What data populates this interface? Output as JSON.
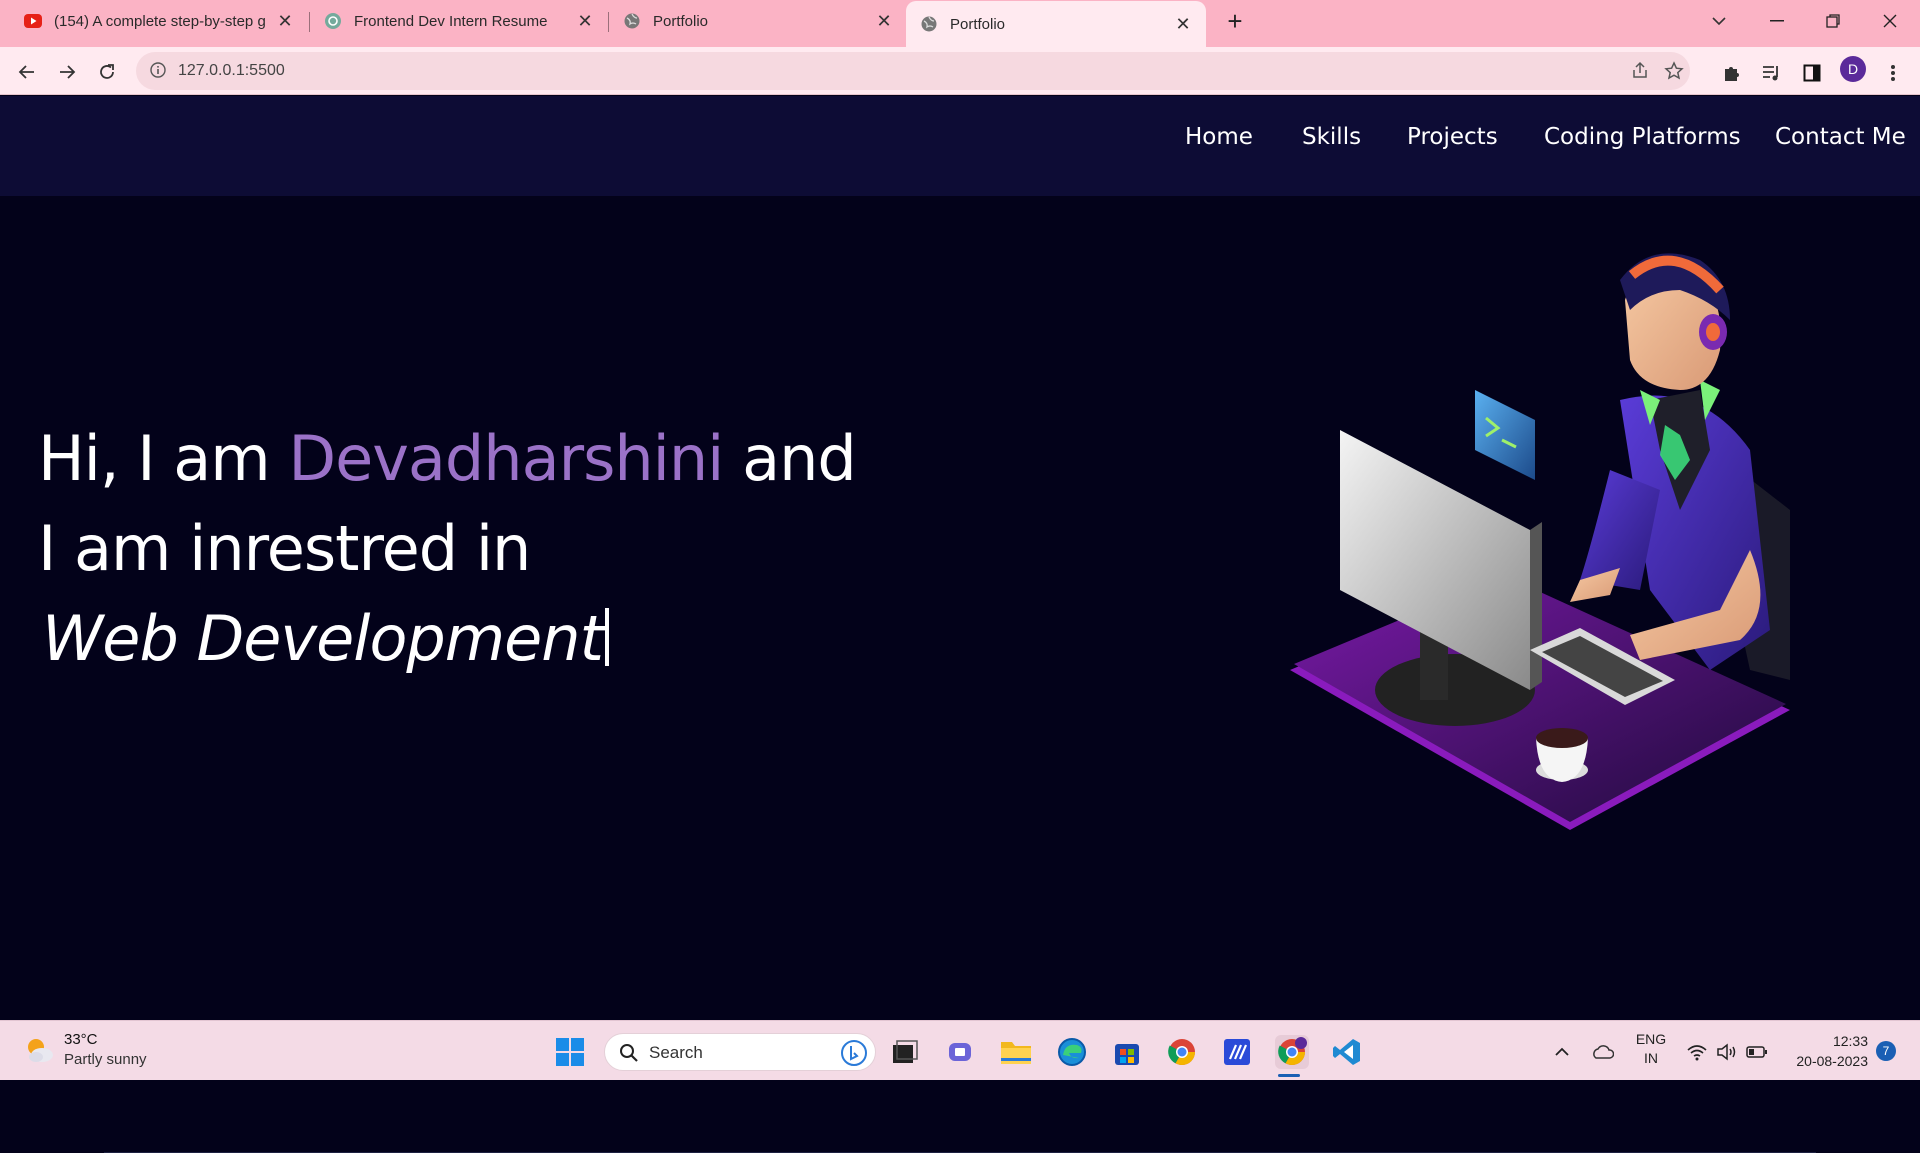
{
  "browser": {
    "tabs": [
      {
        "title": "(154) A complete step-by-step g",
        "favicon": "youtube-icon"
      },
      {
        "title": "Frontend Dev Intern Resume",
        "favicon": "chatgpt-icon"
      },
      {
        "title": "Portfolio",
        "favicon": "globe-icon"
      },
      {
        "title": "Portfolio",
        "favicon": "globe-icon",
        "active": true
      }
    ],
    "url": "127.0.0.1:5500",
    "profile_initial": "D"
  },
  "site": {
    "nav": [
      "Home",
      "Skills",
      "Projects",
      "Coding Platforms",
      "Contact Me"
    ],
    "hero": {
      "line1_prefix": "Hi, I am ",
      "name": "Devadharshini",
      "line1_suffix": " and",
      "line2": "I am inrestred in",
      "typed": "Web Development"
    },
    "colors": {
      "nav_bg": "#0d0c35",
      "page_bg": "#03021a",
      "accent": "#9b72c8"
    }
  },
  "taskbar": {
    "weather_temp": "33°C",
    "weather_condition": "Partly sunny",
    "search_label": "Search",
    "language": "ENG",
    "region": "IN",
    "time": "12:33",
    "date": "20-08-2023",
    "notifications": "7"
  }
}
